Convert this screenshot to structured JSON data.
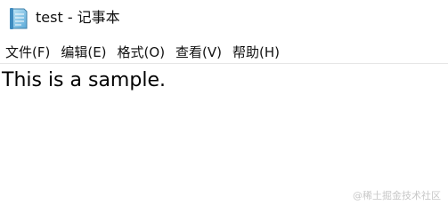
{
  "window": {
    "title": "test - 记事本",
    "icon": "notepad-icon"
  },
  "menubar": {
    "items": [
      {
        "label": "文件(F)"
      },
      {
        "label": "编辑(E)"
      },
      {
        "label": "格式(O)"
      },
      {
        "label": "查看(V)"
      },
      {
        "label": "帮助(H)"
      }
    ]
  },
  "editor": {
    "content": "This is a sample."
  },
  "watermark": {
    "text": "@稀土掘金技术社区"
  },
  "colors": {
    "background": "#ffffff",
    "text": "#000000",
    "icon_blue": "#5aa9d8"
  }
}
